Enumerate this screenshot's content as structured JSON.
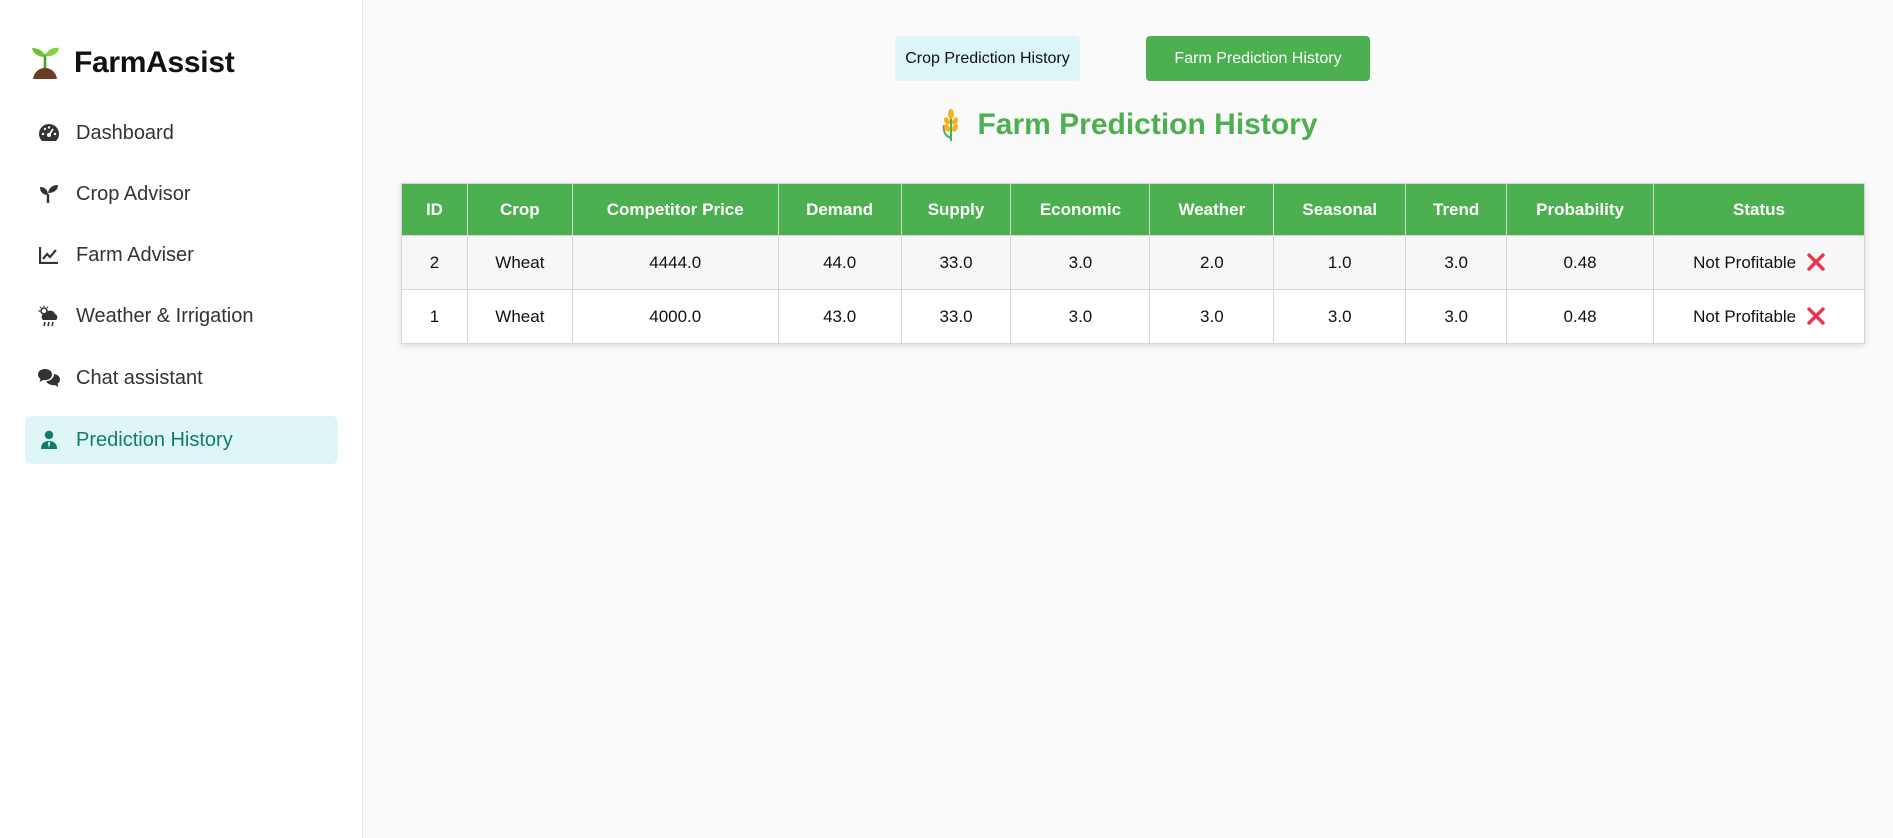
{
  "brand": {
    "title": "FarmAssist"
  },
  "sidebar": {
    "items": [
      {
        "label": "Dashboard",
        "icon": "dashboard-gauge-icon"
      },
      {
        "label": "Crop Advisor",
        "icon": "seedling-icon"
      },
      {
        "label": "Farm Adviser",
        "icon": "line-chart-icon"
      },
      {
        "label": "Weather & Irrigation",
        "icon": "cloud-rain-icon"
      },
      {
        "label": "Chat assistant",
        "icon": "comments-icon"
      },
      {
        "label": "Prediction History",
        "icon": "user-tie-icon",
        "active": true
      }
    ]
  },
  "tabs": {
    "crop": "Crop Prediction History",
    "farm": "Farm Prediction History"
  },
  "page": {
    "title": "Farm Prediction History"
  },
  "table": {
    "headers": [
      "ID",
      "Crop",
      "Competitor Price",
      "Demand",
      "Supply",
      "Economic",
      "Weather",
      "Seasonal",
      "Trend",
      "Probability",
      "Status"
    ],
    "rows": [
      [
        "2",
        "Wheat",
        "4444.0",
        "44.0",
        "33.0",
        "3.0",
        "2.0",
        "1.0",
        "3.0",
        "0.48",
        "Not Profitable"
      ],
      [
        "1",
        "Wheat",
        "4000.0",
        "43.0",
        "33.0",
        "3.0",
        "3.0",
        "3.0",
        "3.0",
        "0.48",
        "Not Profitable"
      ]
    ]
  },
  "colors": {
    "accent": "#4caf50",
    "active_nav_bg": "#dff6f7",
    "active_nav_text": "#0f7d6a",
    "status_negative": "#e8344f"
  }
}
